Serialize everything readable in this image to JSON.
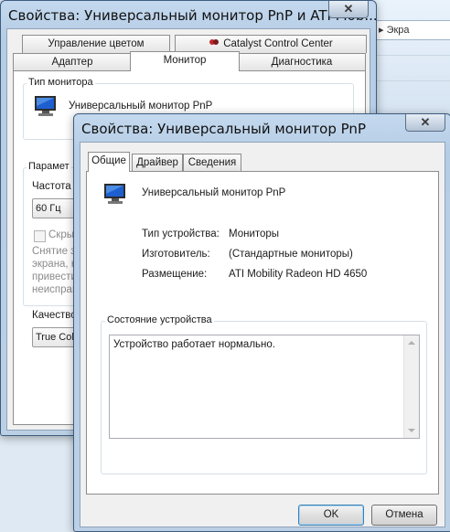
{
  "background_window": {
    "breadcrumb": "▸ Экра"
  },
  "window1": {
    "title": "Свойства: Универсальный монитор PnP и ATI Mob...",
    "close": "✕",
    "tabs_row1": [
      "Управление цветом",
      "Catalyst Control Center"
    ],
    "tabs_row2": [
      "Адаптер",
      "Монитор",
      "Диагностика"
    ],
    "monitor_type_group": "Тип монитора",
    "monitor_name": "Универсальный монитор PnP",
    "params_group": "Парамет",
    "freq_label": "Частота",
    "freq_value": "60 Гц",
    "hide_label": "Скры",
    "hint_lines": [
      "Снятие з",
      "экрана, н",
      "привести",
      "неисправ"
    ],
    "quality_label": "Качество",
    "quality_value": "True Col"
  },
  "window2": {
    "title": "Свойства: Универсальный монитор PnP",
    "close": "✕",
    "tabs": [
      "Общие",
      "Драйвер",
      "Сведения"
    ],
    "device_name": "Универсальный монитор PnP",
    "props": [
      {
        "label": "Тип устройства:",
        "value": "Мониторы"
      },
      {
        "label": "Изготовитель:",
        "value": "(Стандартные мониторы)"
      },
      {
        "label": "Размещение:",
        "value": "ATI Mobility Radeon HD 4650"
      }
    ],
    "status_group": "Состояние устройства",
    "status_text": "Устройство работает нормально.",
    "ok": "OK",
    "cancel": "Отмена"
  },
  "colors": {
    "titlebar": "#bcd0e5",
    "monitor_screen": "#1e5fd0"
  }
}
